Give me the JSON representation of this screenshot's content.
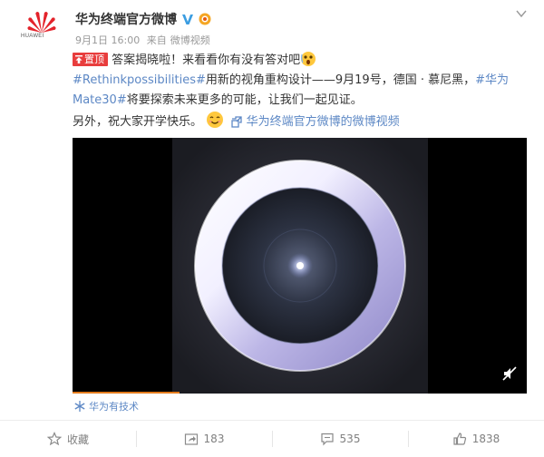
{
  "author": {
    "name": "华为终端官方微博",
    "logo_text": "HUAWEI"
  },
  "post": {
    "date": "9月1日 16:00",
    "source_prefix": "来自",
    "source_name": "微博视频",
    "pinned_label": "置顶",
    "line1_text": "答案揭晓啦！来看看你有没有答对吧",
    "tag_rethink": "#Rethinkpossibilities#",
    "line2_mid": "用新的视角重构设计——9月19号，德国 · 慕尼黑，",
    "tag_huawei_part1": "#华为",
    "tag_huawei_part2": "Mate30#",
    "line3_rest": "将要探索未来更多的可能，让我们一起见证。",
    "line4_text": "另外，祝大家开学快乐。",
    "video_link": "华为终端官方微博的微博视频"
  },
  "video": {
    "progress": 0.235,
    "source_tag": "华为有技术"
  },
  "actions": {
    "favorite": "收藏",
    "forward": "183",
    "comment": "535",
    "like": "1838"
  },
  "colors": {
    "link": "#5d88c5",
    "brand_red": "#e83d3d",
    "progress": "#e37b1c",
    "muted": "#999999"
  },
  "icons": [
    "huawei-logo",
    "verified-icon",
    "level-icon",
    "chevron-down-icon",
    "pin-icon",
    "surprised-emoji",
    "smile-emoji",
    "video-link-icon",
    "mute-icon",
    "snowflake-icon",
    "star-icon",
    "forward-icon",
    "comment-icon",
    "like-icon"
  ]
}
